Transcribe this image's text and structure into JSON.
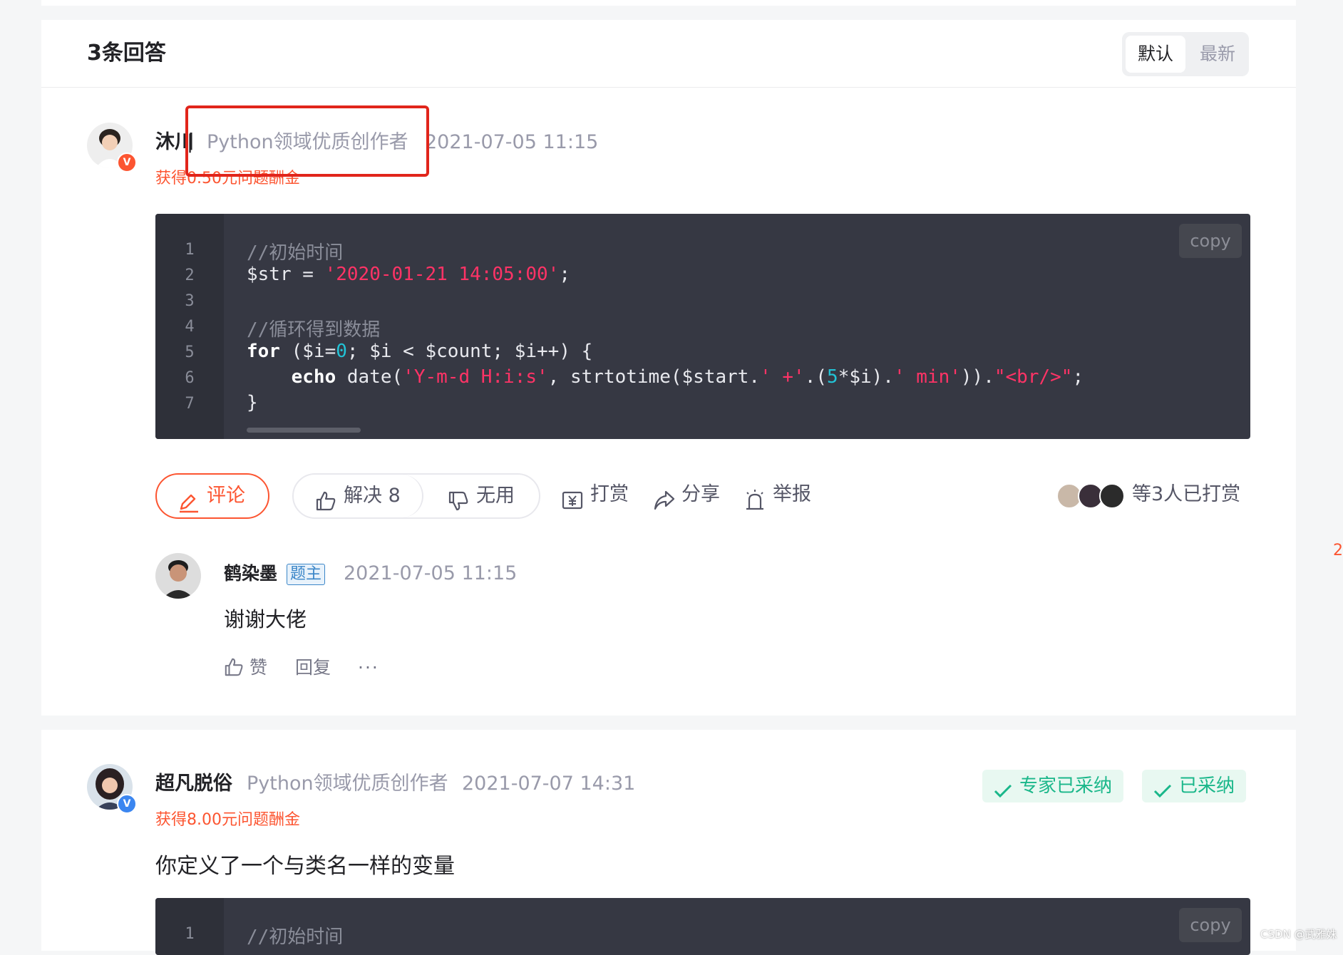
{
  "header": {
    "answer_count": "3条回答",
    "sort_default": "默认",
    "sort_latest": "最新"
  },
  "answer1": {
    "author": "沐川",
    "separator": "|",
    "author_title": "Python领域优质创作者",
    "time": "2021-07-05 11:15",
    "reward": "获得0.50元问题酬金",
    "verified_badge": "V",
    "code": {
      "copy_label": "copy",
      "line_numbers": [
        "1",
        "2",
        "3",
        "4",
        "5",
        "6",
        "7"
      ],
      "l1": "//初始时间",
      "l2_var": "$str = ",
      "l2_str": "'2020-01-21 14:05:00'",
      "l2_end": ";",
      "l4": "//循环得到数据",
      "l5_kw": "for",
      "l5_a": " ($i=",
      "l5_num": "0",
      "l5_b": "; $i < $count; $i++) {",
      "l6_indent": "    ",
      "l6_kw": "echo",
      "l6_a": " date(",
      "l6_s1": "'Y-m-d H:i:s'",
      "l6_b": ", strtotime($start.",
      "l6_s2": "' +'",
      "l6_c": ".(",
      "l6_num": "5",
      "l6_d": "*$i).",
      "l6_s3": "' min'",
      "l6_e": ")).",
      "l6_s4": "\"<br/>\"",
      "l6_f": ";",
      "l7": "}"
    },
    "actions": {
      "comment": "评论",
      "solve": "解决 8",
      "useless": "无用",
      "tip": "打赏",
      "share": "分享",
      "report": "举报",
      "tipped_summary": "等3人已打赏"
    },
    "reply": {
      "author": "鹤染墨",
      "op_tag": "题主",
      "time": "2021-07-05 11:15",
      "text": "谢谢大佬",
      "like": "赞",
      "reply": "回复",
      "more": "···"
    }
  },
  "answer2": {
    "author": "超凡脱俗",
    "author_title": "Python领域优质创作者",
    "time": "2021-07-07 14:31",
    "reward": "获得8.00元问题酬金",
    "verified_badge": "V",
    "expert_accepted": "专家已采纳",
    "accepted": "已采纳",
    "body": "你定义了一个与类名一样的变量",
    "code": {
      "copy_label": "copy",
      "line_numbers": [
        "1"
      ],
      "l1": "//初始时间"
    }
  },
  "edge_mark": "2",
  "watermark": "CSDN @武雅姝",
  "colors": {
    "accent": "#fc5531",
    "highlight_box": "#e1251b",
    "accepted_green": "#1ab78a",
    "code_bg": "#363843",
    "string": "#ff3366",
    "number": "#22c3d6"
  }
}
